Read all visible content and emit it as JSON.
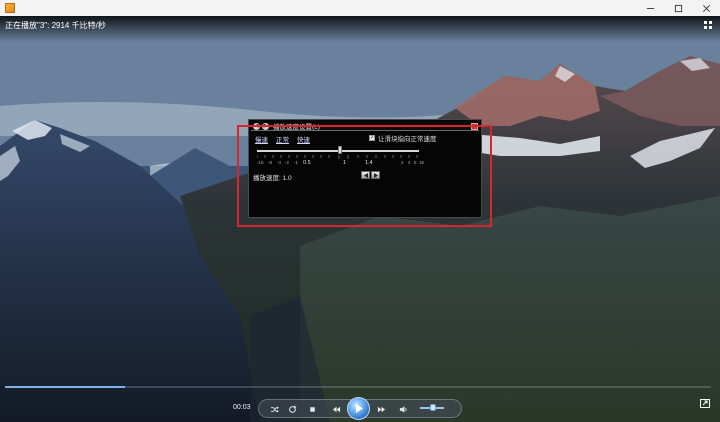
{
  "window": {
    "app_icon": "media-player-app-icon",
    "buttons": [
      "minimize-icon",
      "maximize-icon",
      "close-icon"
    ]
  },
  "player": {
    "status_text": "正在播放\"3\": 2914 千比特/秒",
    "elapsed": "00:03",
    "seek_progress_percent": 17,
    "volume_level_percent": 55
  },
  "speed_dialog": {
    "title": "播放速度设置(L)",
    "links": [
      "慢速",
      "正常",
      "快速"
    ],
    "snap_label": "让滑块指向正常速度",
    "snap_checked": true,
    "slider_value": 1.0,
    "tick_labels": {
      "left": [
        "-16",
        "-8",
        "-4",
        "-2",
        "-1"
      ],
      "half": "0.5",
      "one": "1",
      "one_four": "1.4",
      "right": [
        "2",
        "4",
        "8",
        "16"
      ]
    },
    "readout": "播放速度: 1.0"
  },
  "colors": {
    "highlight": "#d6272d",
    "seek_played": "#7fb0e8",
    "play_button": "#2a6fc2"
  }
}
